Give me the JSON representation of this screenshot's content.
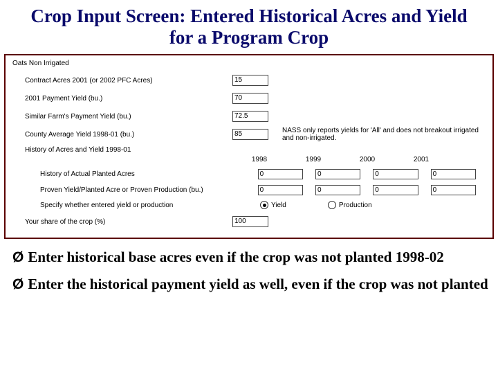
{
  "title": "Crop Input Screen: Entered Historical Acres and Yield for a Program Crop",
  "crop_name": "Oats Non Irrigated",
  "fields": {
    "contract_acres": {
      "label": "Contract Acres 2001 (or 2002 PFC Acres)",
      "value": "15"
    },
    "payment_yield": {
      "label": "2001 Payment Yield (bu.)",
      "value": "70"
    },
    "similar_yield": {
      "label": "Similar Farm's Payment Yield (bu.)",
      "value": "72.5"
    },
    "county_avg": {
      "label": "County Average Yield 1998-01 (bu.)",
      "value": "85",
      "note": "NASS only reports yields for 'All' and does not breakout irrigated and non-irrigated."
    }
  },
  "history": {
    "heading": "History of Acres and Yield 1998-01",
    "years": [
      "1998",
      "1999",
      "2000",
      "2001"
    ],
    "rows": [
      {
        "label": "History of Actual Planted Acres",
        "values": [
          "0",
          "0",
          "0",
          "0"
        ]
      },
      {
        "label": "Proven Yield/Planted Acre or Proven Production (bu.)",
        "values": [
          "0",
          "0",
          "0",
          "0"
        ]
      }
    ],
    "radio": {
      "label": "Specify whether entered yield or production",
      "options": [
        "Yield",
        "Production"
      ],
      "selected": "Yield"
    }
  },
  "share": {
    "label": "Your share of the crop (%)",
    "value": "100"
  },
  "bullets": [
    "Enter historical base acres even if the crop was not planted 1998-02",
    "Enter the historical payment yield as well, even if the crop was not planted"
  ]
}
